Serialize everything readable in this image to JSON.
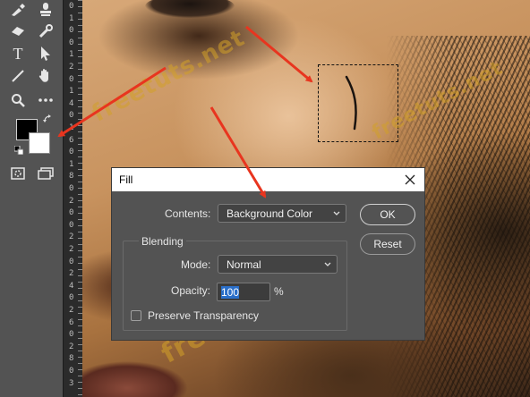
{
  "ruler": {
    "digits": [
      "0",
      "1",
      "0",
      "0",
      "1",
      "2",
      "0",
      "1",
      "4",
      "0",
      "1",
      "6",
      "0",
      "1",
      "8",
      "0",
      "2",
      "0",
      "0",
      "2",
      "2",
      "0",
      "2",
      "4",
      "0",
      "2",
      "6",
      "0",
      "2",
      "8",
      "0",
      "3"
    ]
  },
  "watermark": {
    "text": "freetuts.net"
  },
  "dialog": {
    "title": "Fill",
    "contents_label": "Contents:",
    "contents_value": "Background Color",
    "ok_label": "OK",
    "reset_label": "Reset",
    "blending_title": "Blending",
    "mode_label": "Mode:",
    "mode_value": "Normal",
    "opacity_label": "Opacity:",
    "opacity_value": "100",
    "opacity_unit": "%",
    "preserve_label": "Preserve Transparency",
    "preserve_checked": false
  },
  "colors": {
    "foreground": "#000000",
    "background": "#ffffff",
    "annotation_arrow": "#e8351f",
    "toolbar": "#535353",
    "watermark": "#d2a028"
  },
  "toolbar": {
    "tools": [
      "brush-icon",
      "stamp-icon",
      "eraser-icon",
      "burn-icon",
      "type-icon",
      "path-select-icon",
      "line-icon",
      "hand-icon",
      "zoom-icon",
      "more-icon",
      "quick-mask-icon",
      "screen-mode-icon"
    ]
  }
}
